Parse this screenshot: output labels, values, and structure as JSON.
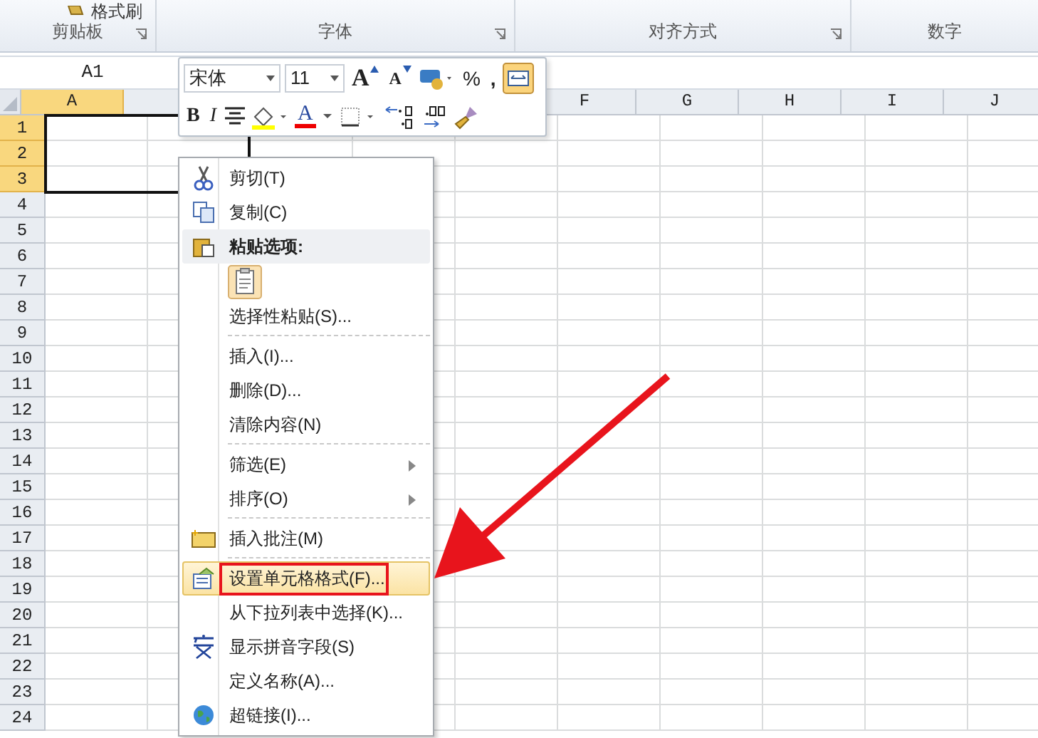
{
  "ribbon": {
    "top_button": "格式刷",
    "groups": [
      {
        "label": "剪贴板",
        "launcher": true
      },
      {
        "label": "字体",
        "launcher": true
      },
      {
        "label": "对齐方式",
        "launcher": true
      },
      {
        "label": "数字",
        "launcher": false
      }
    ]
  },
  "name_box": "A1",
  "columns": [
    {
      "label": "A",
      "selected": true
    },
    {
      "label": "F",
      "selected": false
    },
    {
      "label": "G",
      "selected": false
    },
    {
      "label": "H",
      "selected": false
    },
    {
      "label": "I",
      "selected": false
    },
    {
      "label": "J",
      "selected": false
    }
  ],
  "rows": [
    {
      "label": "1",
      "selected": true
    },
    {
      "label": "2",
      "selected": true
    },
    {
      "label": "3",
      "selected": true
    },
    {
      "label": "4",
      "selected": false
    },
    {
      "label": "5",
      "selected": false
    },
    {
      "label": "6",
      "selected": false
    },
    {
      "label": "7",
      "selected": false
    },
    {
      "label": "8",
      "selected": false
    },
    {
      "label": "9",
      "selected": false
    },
    {
      "label": "10",
      "selected": false
    },
    {
      "label": "11",
      "selected": false
    },
    {
      "label": "12",
      "selected": false
    },
    {
      "label": "13",
      "selected": false
    },
    {
      "label": "14",
      "selected": false
    },
    {
      "label": "15",
      "selected": false
    },
    {
      "label": "16",
      "selected": false
    },
    {
      "label": "17",
      "selected": false
    },
    {
      "label": "18",
      "selected": false
    },
    {
      "label": "19",
      "selected": false
    },
    {
      "label": "20",
      "selected": false
    },
    {
      "label": "21",
      "selected": false
    },
    {
      "label": "22",
      "selected": false
    },
    {
      "label": "23",
      "selected": false
    },
    {
      "label": "24",
      "selected": false
    }
  ],
  "mini_toolbar": {
    "font": "宋体",
    "size": "11",
    "grow": "A",
    "shrink": "A",
    "percent": "%",
    "comma": ",",
    "bold": "B",
    "italic": "I",
    "font_color": "A",
    "wrap_on": true
  },
  "menu": [
    {
      "kind": "cut",
      "label": "剪切(T)",
      "selected": false
    },
    {
      "kind": "copy",
      "label": "复制(C)",
      "selected": false
    },
    {
      "kind": "header",
      "label": "粘贴选项:",
      "selected": false
    },
    {
      "kind": "paste"
    },
    {
      "kind": "item",
      "label": "选择性粘贴(S)...",
      "selected": false
    },
    {
      "kind": "separator"
    },
    {
      "kind": "item",
      "label": "插入(I)...",
      "selected": false
    },
    {
      "kind": "item",
      "label": "删除(D)...",
      "selected": false
    },
    {
      "kind": "item",
      "label": "清除内容(N)",
      "selected": false
    },
    {
      "kind": "separator"
    },
    {
      "kind": "submenu",
      "label": "筛选(E)",
      "selected": false
    },
    {
      "kind": "submenu",
      "label": "排序(O)",
      "selected": false
    },
    {
      "kind": "separator"
    },
    {
      "kind": "comment",
      "label": "插入批注(M)",
      "selected": false
    },
    {
      "kind": "separator"
    },
    {
      "kind": "format",
      "label": "设置单元格格式(F)...",
      "selected": true,
      "annotated": true
    },
    {
      "kind": "item",
      "label": "从下拉列表中选择(K)...",
      "selected": false
    },
    {
      "kind": "pinyin",
      "label": "显示拼音字段(S)",
      "selected": false
    },
    {
      "kind": "item",
      "label": "定义名称(A)...",
      "selected": false
    },
    {
      "kind": "link",
      "label": "超链接(I)...",
      "selected": false
    }
  ]
}
